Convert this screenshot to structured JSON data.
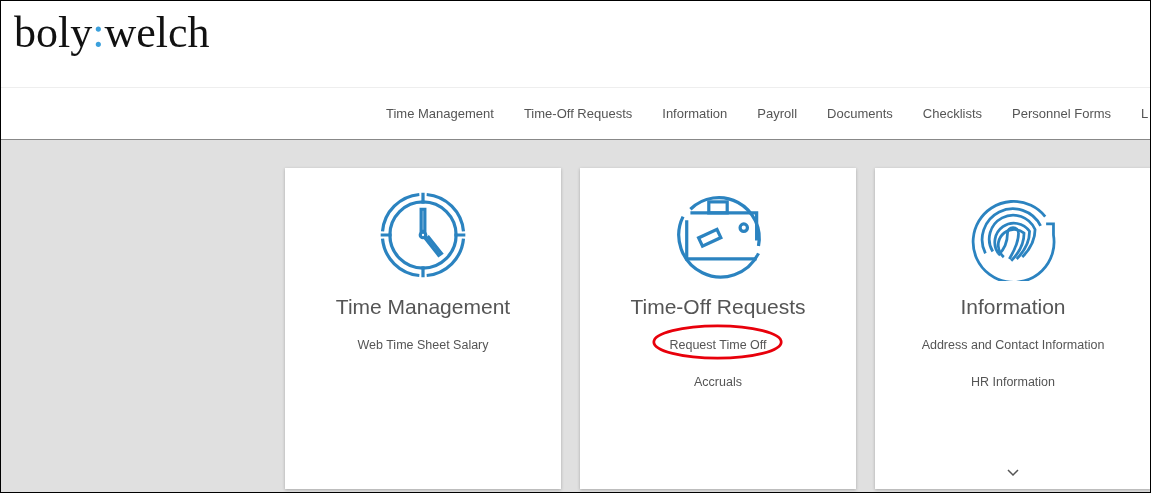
{
  "logo": {
    "left": "boly",
    "separator": ":",
    "right": "welch"
  },
  "nav": [
    {
      "label": "Time Management"
    },
    {
      "label": "Time-Off Requests"
    },
    {
      "label": "Information"
    },
    {
      "label": "Payroll"
    },
    {
      "label": "Documents"
    },
    {
      "label": "Checklists"
    },
    {
      "label": "Personnel Forms"
    },
    {
      "label": "L"
    }
  ],
  "cards": [
    {
      "kind": "clock",
      "title": "Time Management",
      "links": [
        {
          "label": "Web Time Sheet Salary",
          "circled": false
        }
      ],
      "expandable": false
    },
    {
      "kind": "suitcase",
      "title": "Time-Off Requests",
      "links": [
        {
          "label": "Request Time Off",
          "circled": true
        },
        {
          "label": "Accruals",
          "circled": false
        }
      ],
      "expandable": false
    },
    {
      "kind": "fingerprint",
      "title": "Information",
      "links": [
        {
          "label": "Address and Contact Information",
          "circled": false
        },
        {
          "label": "HR Information",
          "circled": false
        }
      ],
      "expandable": true
    }
  ]
}
